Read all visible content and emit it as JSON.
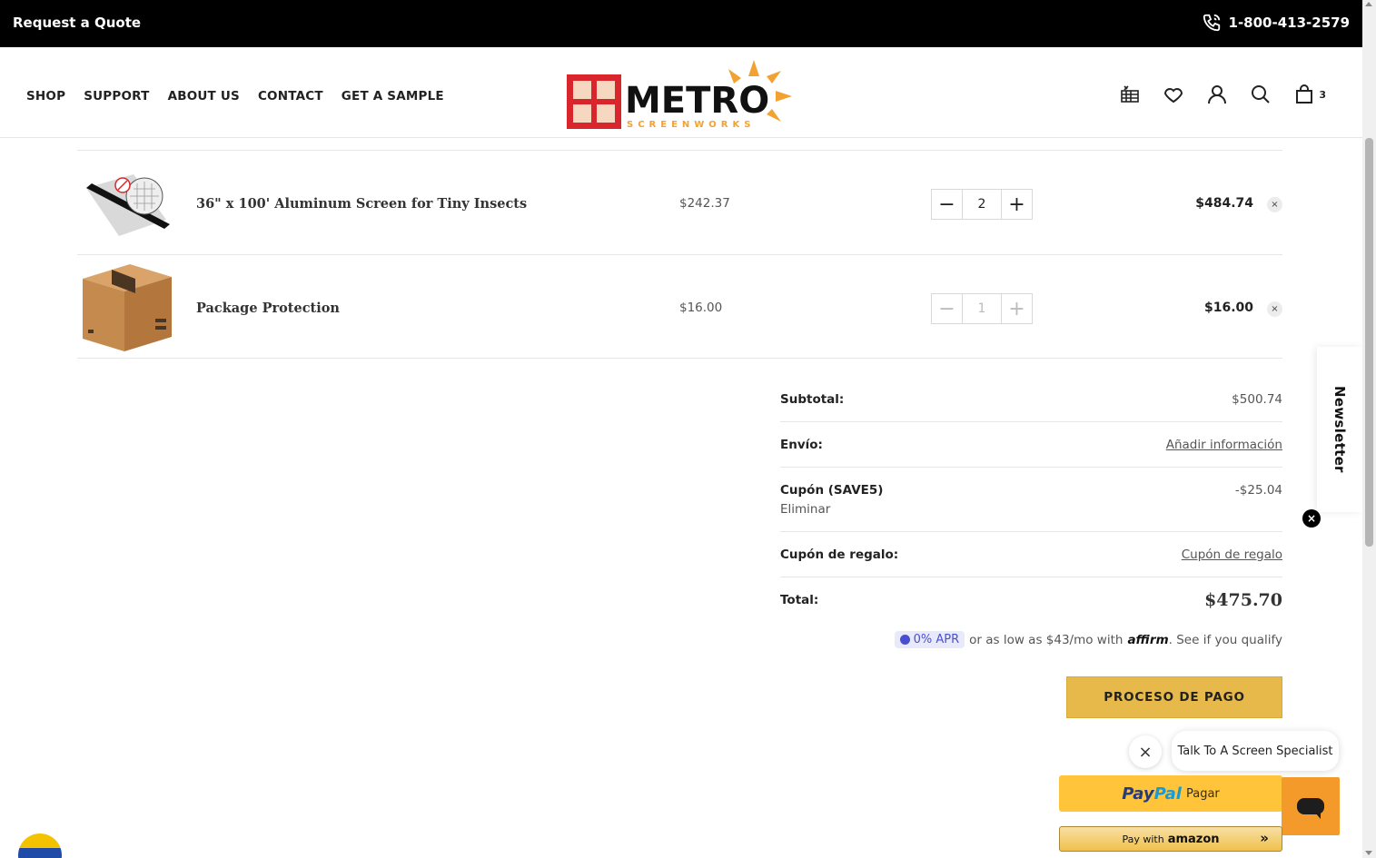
{
  "topbar": {
    "quote_label": "Request a Quote",
    "phone": "1-800-413-2579"
  },
  "nav": {
    "items": [
      "SHOP",
      "SUPPORT",
      "ABOUT US",
      "CONTACT",
      "GET A SAMPLE"
    ]
  },
  "logo": {
    "word": "METRO",
    "tagline": "SCREENWORKS"
  },
  "header_icons": {
    "cart_count": "3"
  },
  "cart": {
    "items": [
      {
        "name": "36\" x 100' Aluminum Screen for Tiny Insects",
        "price": "$242.37",
        "quantity": "2",
        "line_total": "$484.74",
        "remove": "×"
      },
      {
        "name": "Package Protection",
        "price": "$16.00",
        "quantity": "1",
        "line_total": "$16.00",
        "remove": "×"
      }
    ]
  },
  "totals": {
    "subtotal_label": "Subtotal:",
    "subtotal_value": "$500.74",
    "shipping_label": "Envío:",
    "shipping_link": "Añadir información",
    "coupon_label": "Cupón (SAVE5)",
    "coupon_remove": "Eliminar",
    "coupon_value": "-$25.04",
    "gift_label": "Cupón de regalo:",
    "gift_link": "Cupón de regalo",
    "total_label": "Total:",
    "total_value": "$475.70"
  },
  "affirm": {
    "apr": "0% APR",
    "text": "or as low as $43/mo with",
    "brand": "affirm",
    "qualify": ". See if you qualify"
  },
  "checkout": {
    "label": "PROCESO DE PAGO"
  },
  "paypal": {
    "pay": "Pay",
    "pal": "Pal",
    "action": "Pagar"
  },
  "amazon": {
    "prefix": "Pay with",
    "brand": "amazon",
    "chevron": "»"
  },
  "chat": {
    "close": "×",
    "bubble": "Talk To A Screen Specialist"
  },
  "newsletter": {
    "label": "Newsletter",
    "close": "×"
  },
  "colors": {
    "checkout_bg": "#e6b94a",
    "paypal_bg": "#ffc439",
    "chat_bg": "#f39a2b",
    "affirm_accent": "#4a4fd1"
  }
}
